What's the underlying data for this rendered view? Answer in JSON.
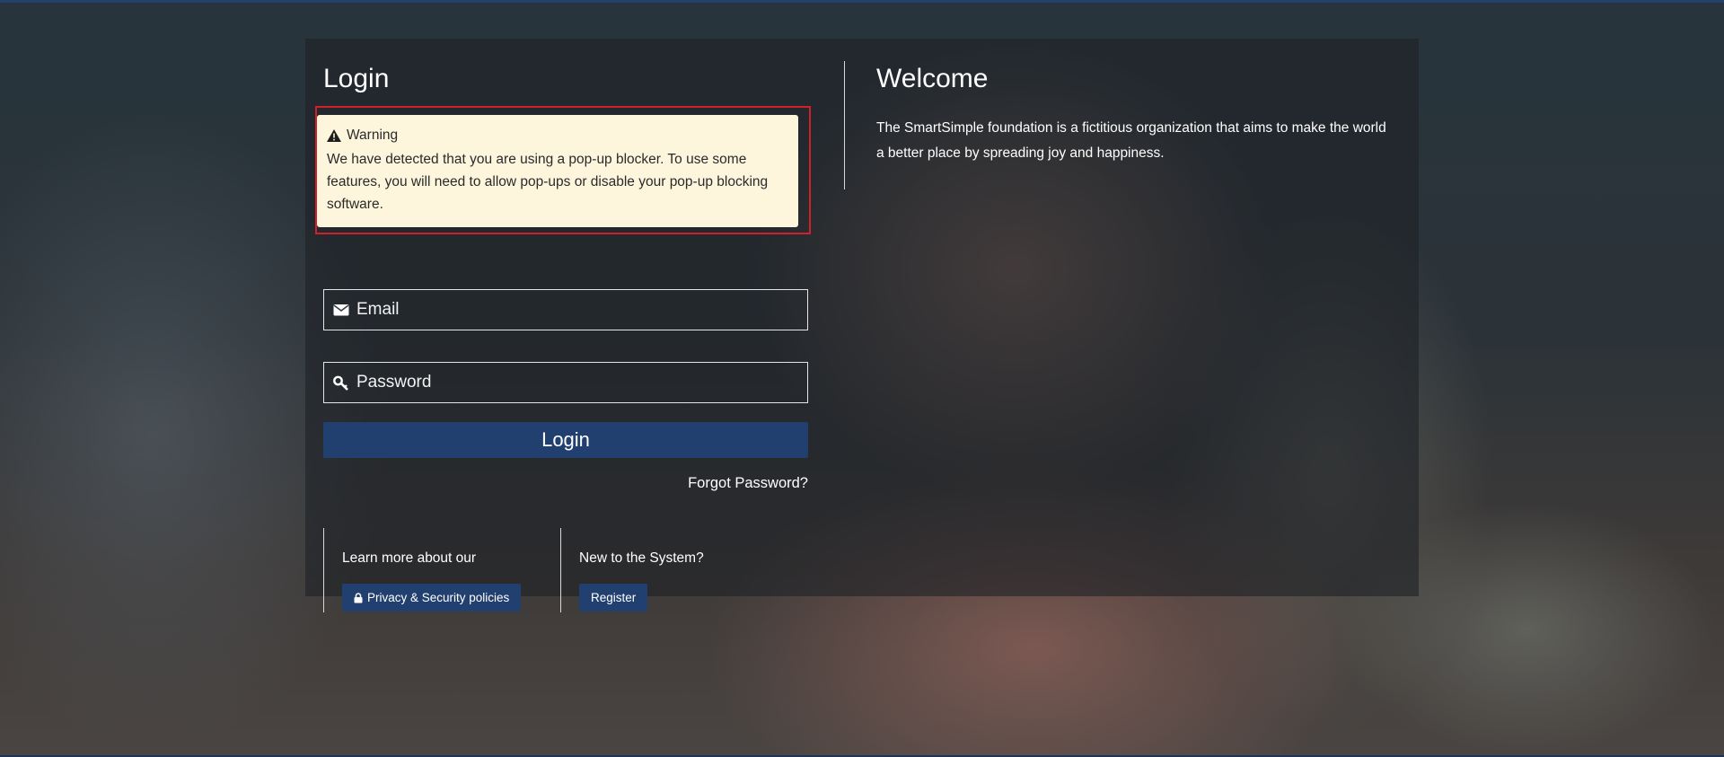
{
  "login": {
    "title": "Login",
    "warning": {
      "heading": "Warning",
      "message": "We have detected that you are using a pop-up blocker. To use some features, you will need to allow pop-ups or disable your pop-up blocking software."
    },
    "email_placeholder": "Email",
    "password_placeholder": "Password",
    "login_button": "Login",
    "forgot_password": "Forgot Password?",
    "learn_more_label": "Learn more about our",
    "privacy_button": "Privacy & Security policies",
    "new_user_label": "New to the System?",
    "register_button": "Register"
  },
  "welcome": {
    "title": "Welcome",
    "text": "The SmartSimple foundation is a fictitious organization that aims to make the world a better place by spreading joy and happiness."
  },
  "colors": {
    "primary_button": "#22406f",
    "warning_background": "#fdf6dd",
    "warning_outline": "#d0202a"
  },
  "icons": {
    "warning": "warning-triangle-icon",
    "email": "envelope-icon",
    "password": "key-icon",
    "privacy": "lock-icon"
  }
}
